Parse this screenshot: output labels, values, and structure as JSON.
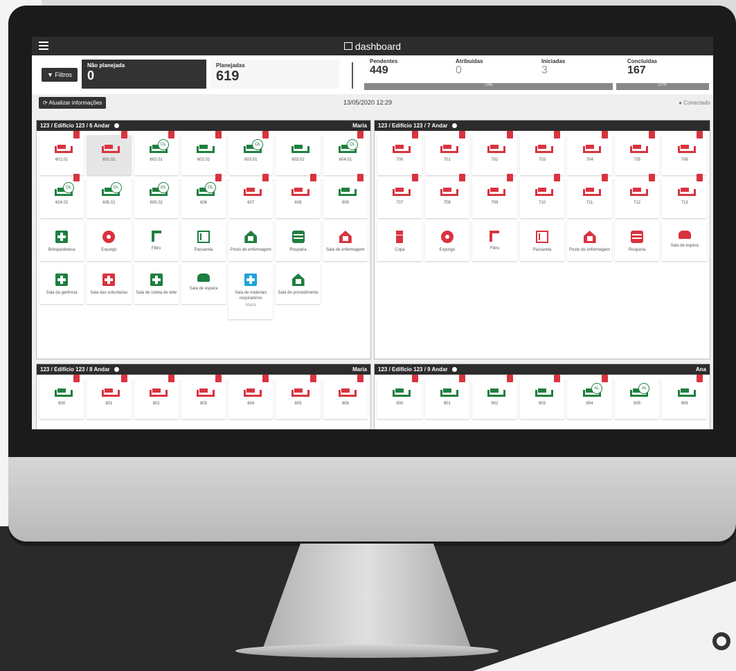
{
  "app": {
    "title": "dashboard"
  },
  "stats": {
    "filter_label": "Filtros",
    "nao_planejada": {
      "label": "Não planejada",
      "value": "0"
    },
    "planejadas": {
      "label": "Planejadas",
      "value": "619"
    },
    "pendentes": {
      "label": "Pendentes",
      "value": "449"
    },
    "atribuidas": {
      "label": "Atribuídas",
      "value": "0"
    },
    "iniciadas": {
      "label": "Iniciadas",
      "value": "3"
    },
    "concluidas": {
      "label": "Concluídas",
      "value": "167"
    },
    "progress_a": "73%",
    "progress_b": "27%"
  },
  "toolbar": {
    "refresh_label": "Atualizar informações",
    "datetime": "13/05/2020 12:29",
    "status": "Conectado"
  },
  "panels": {
    "p6": {
      "title": "123 / Edifício 123 / 6 Andar",
      "user": "Maria",
      "rooms": [
        "601.01",
        "601.02",
        "602.01",
        "602.02",
        "603.01",
        "603.02",
        "604.01",
        "604.02",
        "605.01",
        "605.02",
        "606",
        "607",
        "608",
        "609"
      ],
      "areas": [
        "Brinquedoteca",
        "Expurgo",
        "Filtro",
        "Passarela",
        "Posto de enfermagem",
        "Rouparia",
        "Sala de enfermagem",
        "Sala da gerência",
        "Sala das voluntárias",
        "Sala de coleta de leite",
        "Sala de espera",
        "Sala de materiais respiratórios",
        "Sala de procedimento"
      ],
      "area_user": "Maria"
    },
    "p7": {
      "title": "123 / Edifício 123 / 7 Andar",
      "user": "",
      "rooms": [
        "700",
        "701",
        "702",
        "703",
        "704",
        "705",
        "706",
        "707",
        "708",
        "709",
        "710",
        "711",
        "712",
        "713"
      ],
      "areas": [
        "Copa",
        "Expurgo",
        "Filtro",
        "Passarela",
        "Posto de enfermagem",
        "Rouparia",
        "Sala de espera"
      ]
    },
    "p8": {
      "title": "123 / Edifício 123 / 8 Andar",
      "user": "Maria",
      "rooms": [
        "800",
        "801",
        "802",
        "803",
        "804",
        "805",
        "806"
      ]
    },
    "p9": {
      "title": "123 / Edifício 123 / 9 Andar",
      "user": "Ana",
      "rooms": [
        "900",
        "901",
        "902",
        "903",
        "904",
        "905",
        "906"
      ]
    }
  },
  "badges": {
    "ol": "OL",
    "al": "AL"
  }
}
